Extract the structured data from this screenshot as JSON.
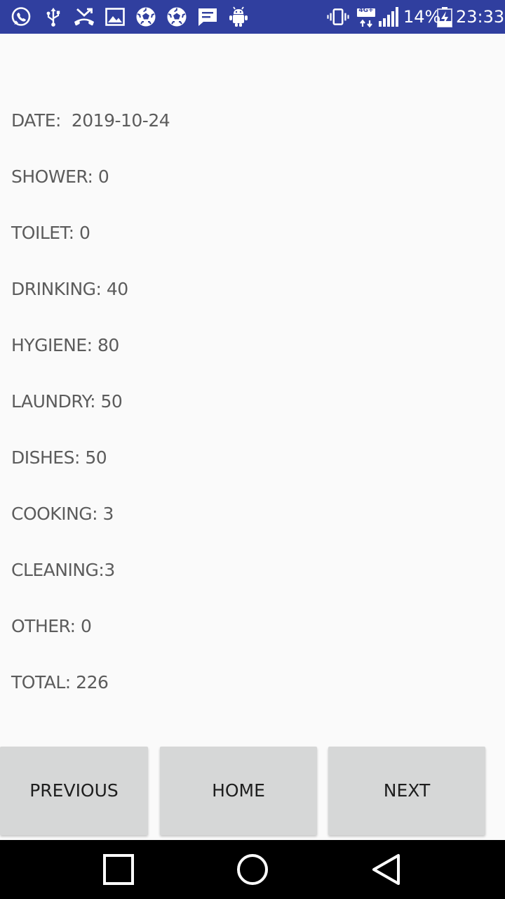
{
  "status_bar": {
    "battery_percent": "14%",
    "time": "23:33",
    "network_type": "4G+",
    "left_icons": [
      "whatsapp-icon",
      "usb-icon",
      "missed-call-icon",
      "gallery-icon",
      "soccer-ball-icon",
      "soccer-ball-icon",
      "message-icon",
      "android-debug-icon"
    ],
    "right_icons": [
      "vibrate-icon",
      "mobile-data-icon",
      "signal-icon",
      "battery-charging-icon"
    ],
    "background": "#303f9f"
  },
  "records": {
    "date": "DATE:  2019-10-24",
    "shower": "SHOWER: 0",
    "toilet": "TOILET: 0",
    "drinking": "DRINKING: 40",
    "hygiene": "HYGIENE: 80",
    "laundry": "LAUNDRY: 50",
    "dishes": "DISHES: 50",
    "cooking": "COOKING: 3",
    "cleaning": "CLEANING:3",
    "other": "OTHER: 0",
    "total": "TOTAL: 226"
  },
  "buttons": {
    "previous": "PREVIOUS",
    "home": "HOME",
    "next": "NEXT"
  },
  "nav_bar": {
    "icons": [
      "recent-apps-icon",
      "home-icon",
      "back-icon"
    ]
  },
  "colors": {
    "background": "#fafafa",
    "text": "#5c5c5c",
    "button": "#d6d7d7"
  }
}
